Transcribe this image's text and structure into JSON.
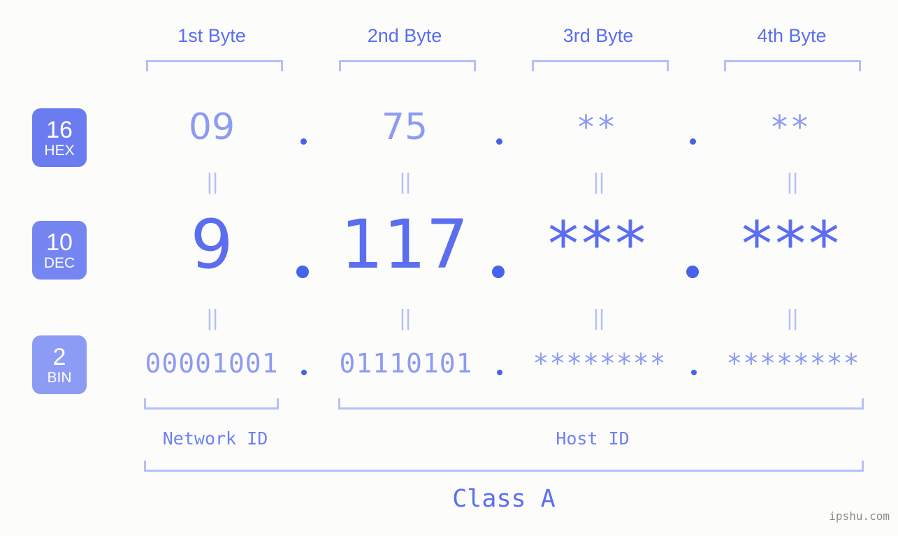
{
  "background_color": "#fcfdfa",
  "accent_color": "#5b6ef0",
  "accent_light_color": "#8e9bf2",
  "bracket_color": "#b6bffa",
  "headers": {
    "byte1": "1st Byte",
    "byte2": "2nd Byte",
    "byte3": "3rd Byte",
    "byte4": "4th Byte"
  },
  "bases": [
    {
      "number": "16",
      "label": "HEX",
      "color": "#6b7cf0"
    },
    {
      "number": "10",
      "label": "DEC",
      "color": "#7585f1"
    },
    {
      "number": "2",
      "label": "BIN",
      "color": "#8c9cf5"
    }
  ],
  "rows": {
    "hex": {
      "base_number": "16",
      "base_label": "HEX",
      "values": [
        "09",
        "75",
        "**",
        "**"
      ]
    },
    "dec": {
      "base_number": "10",
      "base_label": "DEC",
      "values": [
        "9",
        "117",
        "***",
        "***"
      ]
    },
    "bin": {
      "base_number": "2",
      "base_label": "BIN",
      "values": [
        "00001001",
        "01110101",
        "********",
        "********"
      ]
    }
  },
  "separator_dot": ".",
  "equals_mark": "||",
  "equals_marks": [
    "||",
    "||",
    "||",
    "||"
  ],
  "footer": {
    "network_id_label": "Network ID",
    "host_id_label": "Host ID",
    "class_label": "Class A",
    "watermark": "ipshu.com"
  }
}
